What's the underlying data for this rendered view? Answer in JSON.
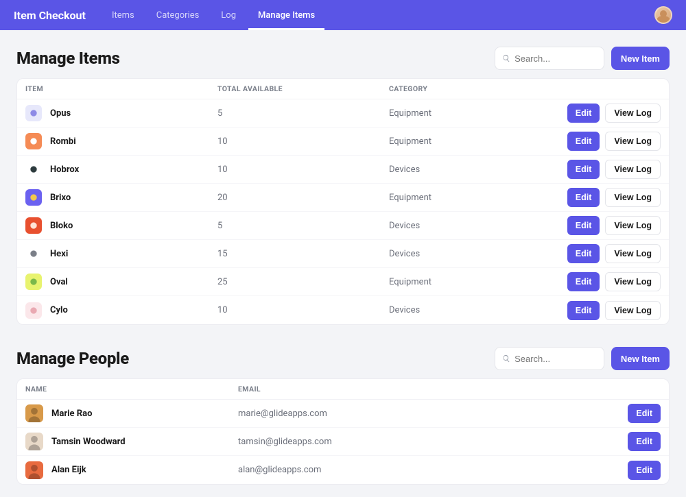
{
  "brand": "Item Checkout",
  "nav": {
    "items": [
      "Items",
      "Categories",
      "Log",
      "Manage Items"
    ],
    "activeIndex": 3
  },
  "sections": {
    "items": {
      "title": "Manage Items",
      "searchPlaceholder": "Search...",
      "newButton": "New Item",
      "headers": {
        "item": "ITEM",
        "avail": "TOTAL AVAILABLE",
        "cat": "CATEGORY"
      },
      "editLabel": "Edit",
      "viewLogLabel": "View Log",
      "rows": [
        {
          "name": "Opus",
          "avail": "5",
          "cat": "Equipment",
          "iconBg": "#e7e8fb",
          "iconFg": "#8d8ae6"
        },
        {
          "name": "Rombi",
          "avail": "10",
          "cat": "Equipment",
          "iconBg": "#f58b55",
          "iconFg": "#ffffff"
        },
        {
          "name": "Hobrox",
          "avail": "10",
          "cat": "Devices",
          "iconBg": "#ffffff",
          "iconFg": "#2d3b3e"
        },
        {
          "name": "Brixo",
          "avail": "20",
          "cat": "Equipment",
          "iconBg": "#6b61f0",
          "iconFg": "#f2c84b"
        },
        {
          "name": "Bloko",
          "avail": "5",
          "cat": "Devices",
          "iconBg": "#e8502f",
          "iconFg": "#ffe3d6"
        },
        {
          "name": "Hexi",
          "avail": "15",
          "cat": "Devices",
          "iconBg": "#ffffff",
          "iconFg": "#7b7f88"
        },
        {
          "name": "Oval",
          "avail": "25",
          "cat": "Equipment",
          "iconBg": "#e8f36f",
          "iconFg": "#7bb84a"
        },
        {
          "name": "Cylo",
          "avail": "10",
          "cat": "Devices",
          "iconBg": "#fbe7ea",
          "iconFg": "#e9a9b2"
        }
      ]
    },
    "people": {
      "title": "Manage People",
      "searchPlaceholder": "Search...",
      "newButton": "New Item",
      "headers": {
        "name": "NAME",
        "email": "EMAIL"
      },
      "editLabel": "Edit",
      "rows": [
        {
          "name": "Marie Rao",
          "email": "marie@glideapps.com",
          "avatarBg": "#d89a4a"
        },
        {
          "name": "Tamsin Woodward",
          "email": "tamsin@glideapps.com",
          "avatarBg": "#e8d9c8"
        },
        {
          "name": "Alan Eijk",
          "email": "alan@glideapps.com",
          "avatarBg": "#e86b3f"
        }
      ]
    }
  }
}
